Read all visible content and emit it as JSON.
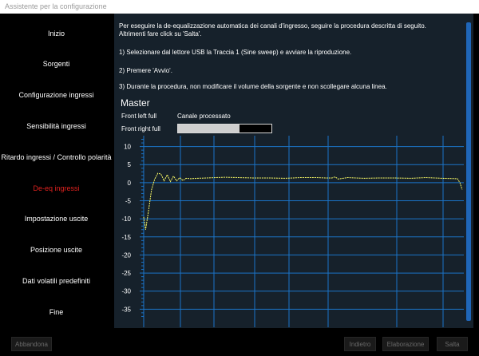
{
  "window": {
    "title": "Assistente per la configurazione"
  },
  "sidebar": {
    "items": [
      {
        "label": "Inizio"
      },
      {
        "label": "Sorgenti"
      },
      {
        "label": "Configurazione ingressi"
      },
      {
        "label": "Sensibilità ingressi"
      },
      {
        "label": "Ritardo ingressi / Controllo polarità"
      },
      {
        "label": "De-eq ingressi",
        "active": true
      },
      {
        "label": "Impostazione uscite"
      },
      {
        "label": "Posizione uscite"
      },
      {
        "label": "Dati volatili predefiniti"
      },
      {
        "label": "Fine"
      }
    ]
  },
  "main": {
    "intro_line1": "Per eseguire la de-equalizzazione automatica dei canali d'ingresso, seguire la procedura descritta di seguito.",
    "intro_line2": "Altrimenti fare click su 'Salta'.",
    "step1": "1) Selezionare dal lettore USB la Traccia 1 (Sine sweep) e avviare la riproduzione.",
    "step2": "2) Premere 'Avvio'.",
    "step3": "3) Durante la procedura, non modificare il volume della sorgente e non scollegare alcuna linea.",
    "master_title": "Master",
    "channel1": "Front left full",
    "channel2": "Front right full",
    "processed_label": "Canale processato",
    "progress": 0.66
  },
  "chart_data": {
    "type": "line",
    "title": "",
    "xlabel": "",
    "ylabel": "",
    "ylim": [
      -40,
      13
    ],
    "yticks": [
      10,
      5,
      0,
      -5,
      -10,
      -15,
      -20,
      -25,
      -30,
      -35
    ],
    "series": [
      {
        "color": "#ffff66",
        "x": [
          0,
          0.6,
          1.5,
          2.5,
          3.5,
          4.5,
          5.5,
          6.5,
          7.5,
          8.5,
          9.5,
          10.5,
          11.5,
          12.5,
          13.5,
          15,
          17,
          20,
          23,
          26,
          30,
          35,
          40,
          45,
          50,
          55,
          58,
          60,
          61,
          62,
          65,
          70,
          75,
          80,
          85,
          90,
          95,
          100,
          100.8,
          101.5
        ],
        "values": [
          -9.5,
          -13,
          -8,
          -2,
          1,
          2.6,
          2.4,
          0.5,
          2.2,
          0.3,
          1.8,
          0.5,
          1.4,
          0.6,
          1.2,
          1.1,
          1.2,
          1.3,
          1.4,
          1.5,
          1.4,
          1.3,
          1.3,
          1.2,
          1.4,
          1.4,
          1.3,
          1.3,
          1.6,
          1.0,
          1.4,
          1.2,
          1.3,
          1.3,
          1.2,
          1.4,
          1.2,
          1.1,
          0,
          -1.9
        ]
      }
    ]
  },
  "buttons": {
    "abort": "Abbandona",
    "back": "Indietro",
    "process": "Elaborazione",
    "skip": "Salta"
  },
  "colors": {
    "grid": "#1b74c8",
    "trace": "#ffff66",
    "active_nav": "#e0221f",
    "panel_bg": "#16212b"
  }
}
